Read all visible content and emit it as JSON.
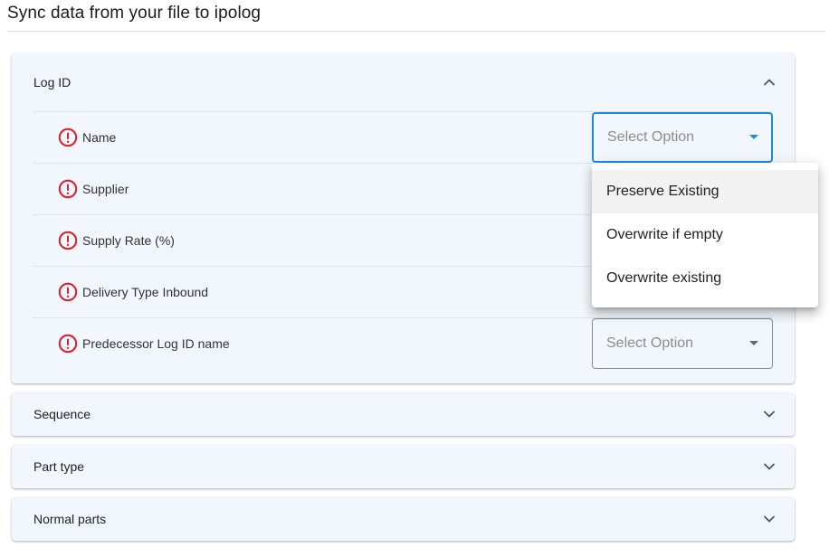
{
  "page": {
    "title": "Sync data from your file to ipolog"
  },
  "sections": [
    {
      "title": "Log ID",
      "expanded": true,
      "chevron_icon": "chevron-up-icon",
      "rows": [
        {
          "label": "Name",
          "status_icon": "error-circle-icon",
          "select_placeholder": "Select Option",
          "select_focused": true
        },
        {
          "label": "Supplier",
          "status_icon": "error-circle-icon"
        },
        {
          "label": "Supply Rate (%)",
          "status_icon": "error-circle-icon"
        },
        {
          "label": "Delivery Type Inbound",
          "status_icon": "error-circle-icon"
        },
        {
          "label": "Predecessor Log ID name",
          "status_icon": "error-circle-icon",
          "select_placeholder": "Select Option"
        }
      ]
    },
    {
      "title": "Sequence",
      "expanded": false,
      "chevron_icon": "chevron-down-icon"
    },
    {
      "title": "Part type",
      "expanded": false,
      "chevron_icon": "chevron-down-icon"
    },
    {
      "title": "Normal parts",
      "expanded": false,
      "chevron_icon": "chevron-down-icon"
    }
  ],
  "dropdown_menu": {
    "options": [
      "Preserve Existing",
      "Overwrite if empty",
      "Overwrite existing"
    ],
    "highlighted_index": 0
  },
  "colors": {
    "panel_background": "#f1f7fc",
    "error_icon": "#e01b24",
    "focus_accent": "#1e88e5",
    "menu_highlight": "#f2f2f2"
  }
}
